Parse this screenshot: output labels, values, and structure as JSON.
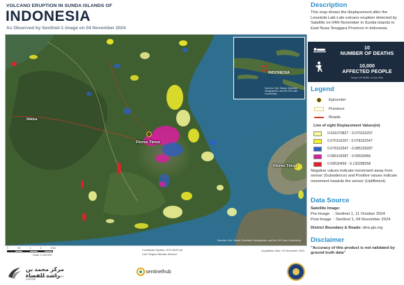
{
  "header": {
    "sup_title": "VOLCANO ERUPTION IN SUNDA ISLANDS OF",
    "title": "INDONESIA",
    "subtitle": "As Observed by Sentinel-1 image on 04 November 2024"
  },
  "map": {
    "place_labels": [
      "Nikka",
      "Flores Timur",
      "Flores Timur"
    ],
    "credit": "Sources: Esri, Maxar, Earthstar Geographics, and the GIS User Community",
    "inset": {
      "label": "INDONESIA",
      "credit": "Sources: Esri, Maxar, Earthstar Geographics, and the GIS User Community"
    },
    "epicenter_color": "#f2d12b",
    "palette": [
      "#fafa9a",
      "#f5ef2a",
      "#2f5ec8",
      "#d81f9e",
      "#e4202a"
    ]
  },
  "map_footer": {
    "scale_text": "Scale 1:100,000",
    "coord_system": "Coordinate System: GCS WGS 84",
    "coord_unit": "Unit: Degree Minutes Second",
    "acquisition": "Acquisition Date: 04 November 2024",
    "scale_ticks": [
      "0",
      "0.5",
      "1",
      "2",
      "3 Km"
    ]
  },
  "logos": {
    "mbrsc_arabic": "مركز محمد بن راشد للفضاء",
    "mbrsc_english": "MOHAMMED BIN RASHID SPACE CENTRE",
    "sentinelhub": "sentinelhub"
  },
  "side": {
    "description_head": "Description",
    "description_text": "This map shows the displacement after the Lewotobi Laki-Laki volcano eruption detected by Satellite on 04th November in Sunda Islands in East Nusa Tenggara Province in Indonesia.",
    "stats": {
      "deaths_value": "10",
      "deaths_label": "NUMBER OF DEATHS",
      "affected_value": "10,000",
      "affected_label": "AFFECTED PEOPLE",
      "source": "Source: AP NEWS, 04 Nov 2024"
    },
    "legend_head": "Legend",
    "legend_items": {
      "epicenter": "Epicenter",
      "province": "Province",
      "roads": "Roads"
    },
    "displacement_title": "Line of sight Displacement Values(m)",
    "classes": [
      {
        "label": "0.041079827 - 0.070116297",
        "color": "#fafa9a"
      },
      {
        "label": "0.070116297 - 0.078162547",
        "color": "#f5ef2a"
      },
      {
        "label": "0.078162547 - 0.085159287",
        "color": "#2f5ec8"
      },
      {
        "label": "0.085159287 - 0.09530456",
        "color": "#d81f9e"
      },
      {
        "label": "0.09530456 - 0.130288258",
        "color": "#e4202a"
      }
    ],
    "negative_note": "Negative values indicate movement away from sensor (Subsidence) and Positive values indicate movement towards the sensor (Upliftment).",
    "data_source_head": "Data Source",
    "satellite_label": "Satellite Image:",
    "pre_image": "Pre-Image   : Sentinel 1, 11 October 2024",
    "post_image": "Post-Image  : Sentinel 1, 04 November 2024",
    "district_label": "District Boundary & Roads:",
    "district_value": "diva-gis.org",
    "disclaimer_head": "Disclaimer",
    "disclaimer_text": "\"Accuracy of this product is not validated by ground truth data\""
  }
}
